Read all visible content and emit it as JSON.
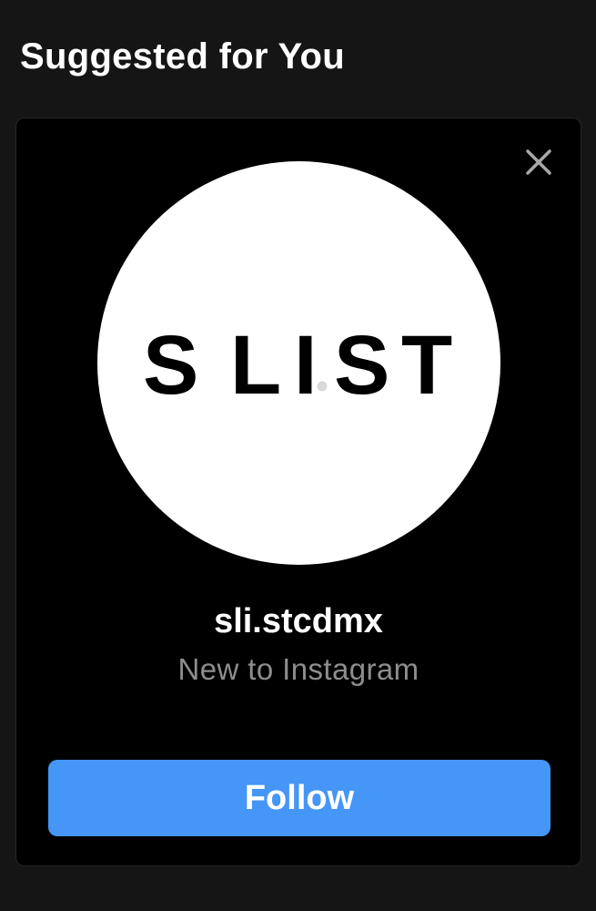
{
  "section": {
    "title": "Suggested for You"
  },
  "suggestion": {
    "close_icon": "close-icon",
    "avatar_logo_text": "SLIST",
    "username": "sli.stcdmx",
    "subtitle": "New to Instagram",
    "follow_label": "Follow"
  },
  "colors": {
    "background": "#151515",
    "card": "#000000",
    "follow_button": "#4596f6",
    "subtitle_text": "#8e8e8e",
    "close_icon": "#a8a8a8"
  }
}
